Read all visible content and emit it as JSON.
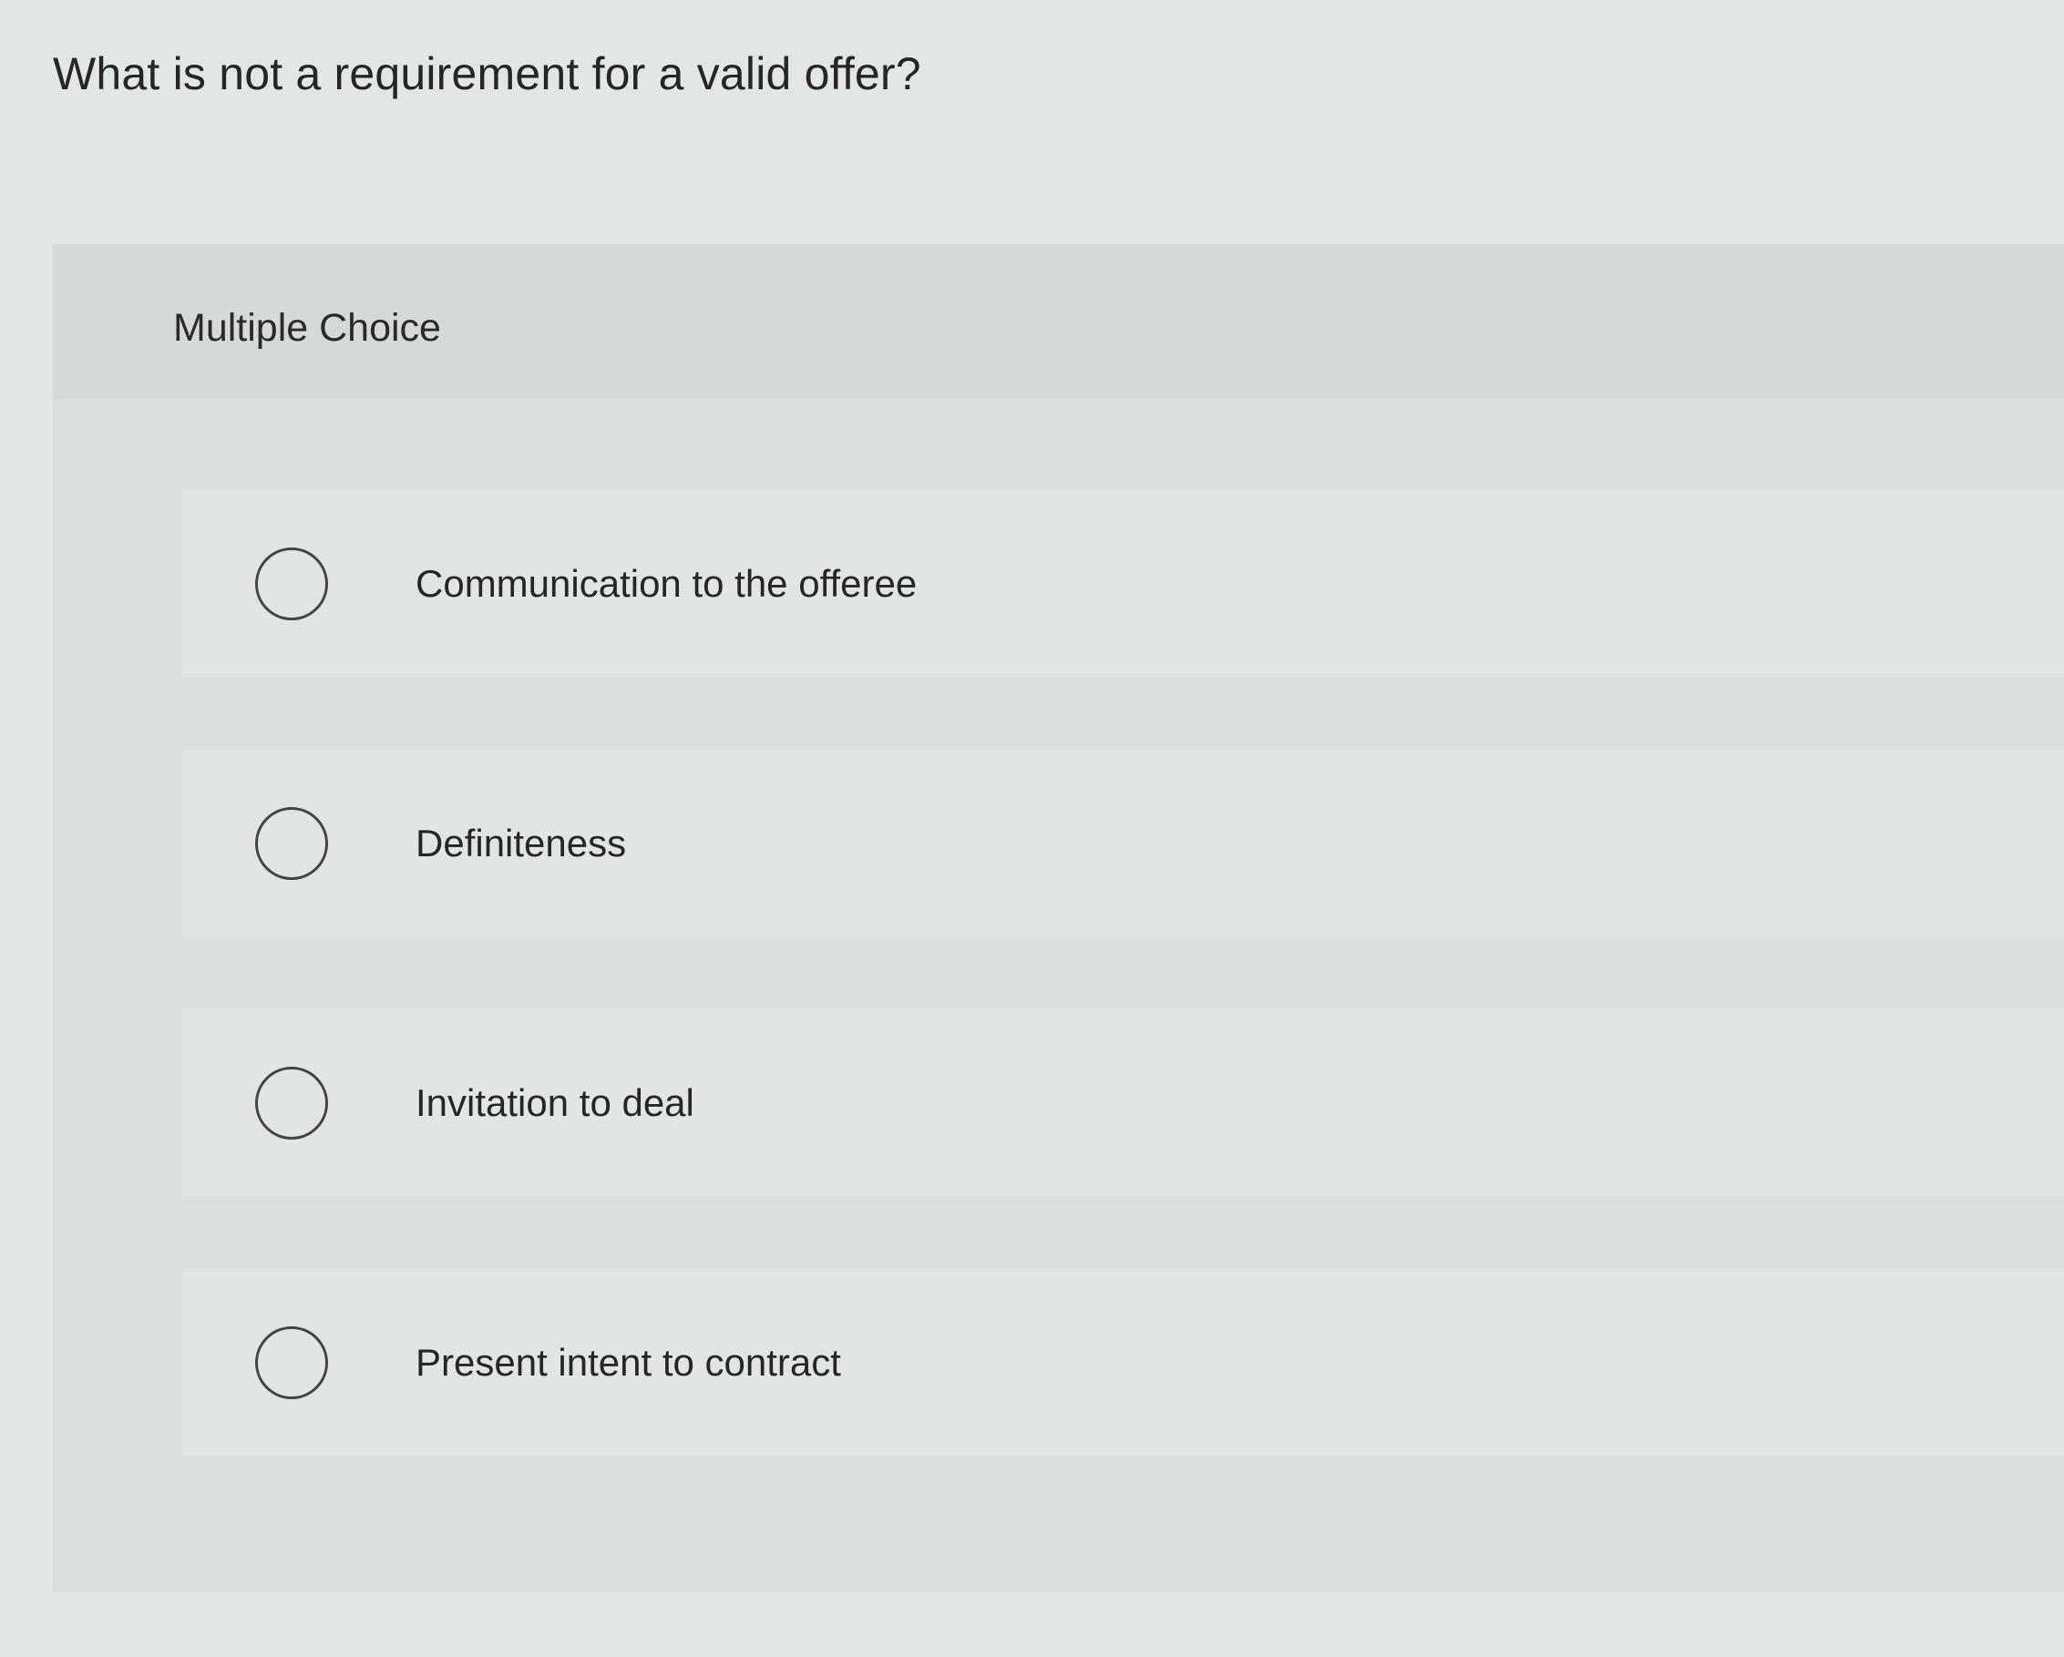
{
  "question": {
    "text": "What is not a requirement for a valid offer?"
  },
  "multiple_choice": {
    "label": "Multiple Choice",
    "options": [
      {
        "label": "Communication to the offeree",
        "selected": false
      },
      {
        "label": "Definiteness",
        "selected": false
      },
      {
        "label": "Invitation to deal",
        "selected": false
      },
      {
        "label": "Present intent to contract",
        "selected": false
      }
    ]
  }
}
